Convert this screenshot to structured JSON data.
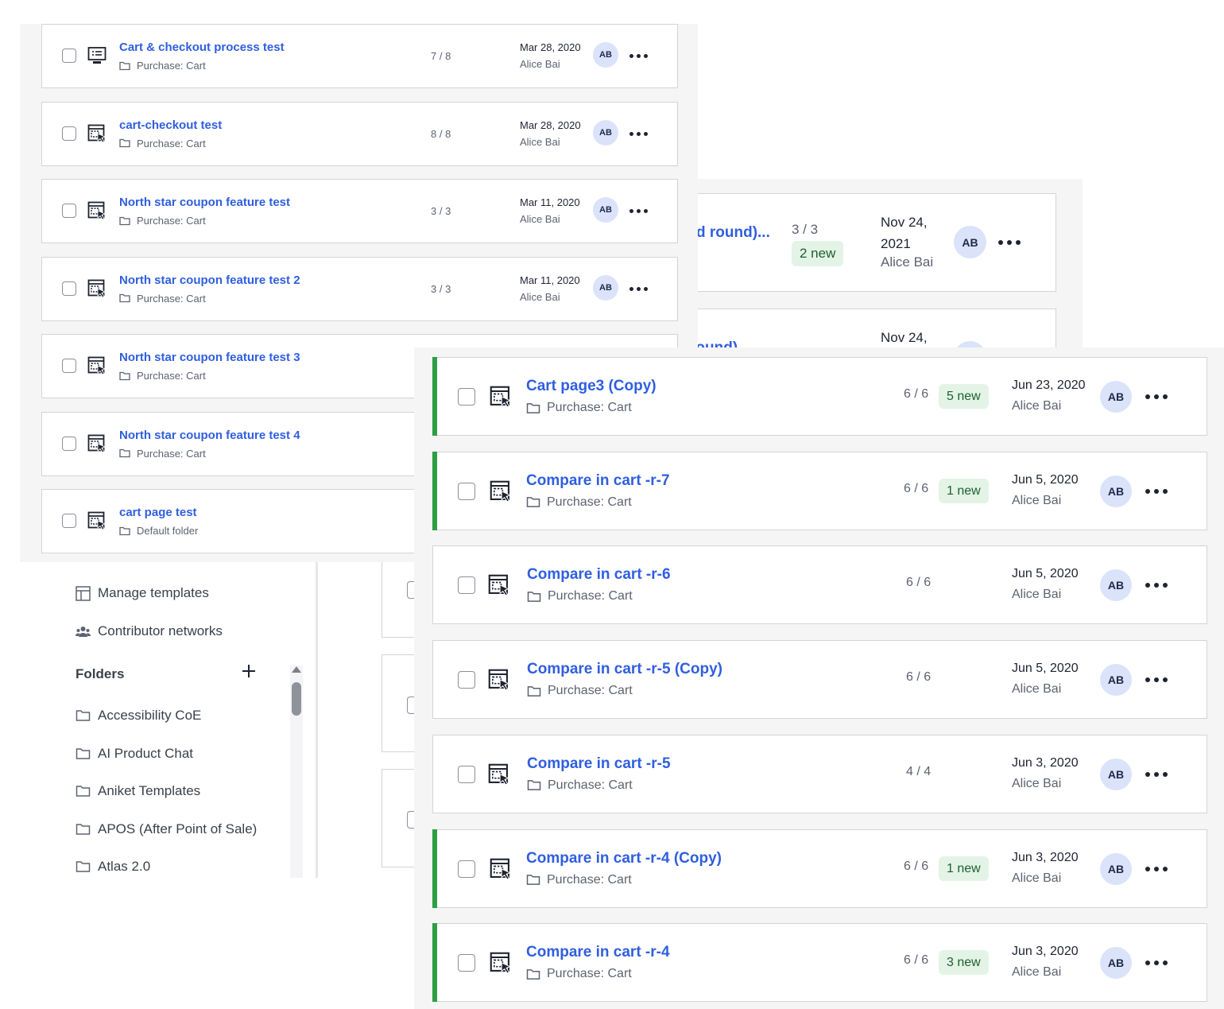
{
  "tests_small": [
    {
      "title": "Cart & checkout process test",
      "folder": "Purchase: Cart",
      "count": "7 / 8",
      "date": "Mar 28, 2020",
      "owner": "Alice Bai",
      "initials": "AB",
      "icon": "desktop-icon"
    },
    {
      "title": "cart-checkout test",
      "folder": "Purchase: Cart",
      "count": "8 / 8",
      "date": "Mar 28, 2020",
      "owner": "Alice Bai",
      "initials": "AB",
      "icon": "prototype-icon"
    },
    {
      "title": "North star coupon feature test",
      "folder": "Purchase: Cart",
      "count": "3 / 3",
      "date": "Mar 11, 2020",
      "owner": "Alice Bai",
      "initials": "AB",
      "icon": "prototype-icon"
    },
    {
      "title": "North star coupon feature test 2",
      "folder": "Purchase: Cart",
      "count": "3 / 3",
      "date": "Mar 11, 2020",
      "owner": "Alice Bai",
      "initials": "AB",
      "icon": "prototype-icon"
    },
    {
      "title": "North star coupon feature test 3",
      "folder": "Purchase: Cart",
      "icon": "prototype-icon"
    },
    {
      "title": "North star coupon feature test 4",
      "folder": "Purchase: Cart",
      "icon": "prototype-icon"
    },
    {
      "title": "cart page test",
      "folder": "Default folder",
      "icon": "prototype-icon"
    }
  ],
  "partial_row": {
    "title": "d round)...",
    "count": "3 / 3",
    "badge": "2 new",
    "date": "Nov 24, 2021",
    "owner": "Alice Bai",
    "initials": "AB"
  },
  "partial_row_2": {
    "title": "round)",
    "date": "Nov 24,"
  },
  "sidebar": {
    "items": [
      {
        "label": "Manage templates",
        "icon": "template-icon"
      },
      {
        "label": "Contributor networks",
        "icon": "people-icon"
      }
    ],
    "folders_title": "Folders",
    "folders": [
      "Accessibility CoE",
      "AI Product Chat",
      "Aniket Templates",
      "APOS (After Point of Sale)",
      "Atlas 2.0"
    ]
  },
  "tests_large": [
    {
      "title": "Cart page3 (Copy)",
      "folder": "Purchase: Cart",
      "count": "6 / 6",
      "badge": "5 new",
      "date": "Jun 23, 2020",
      "owner": "Alice Bai",
      "initials": "AB",
      "accent": true
    },
    {
      "title": "Compare in cart -r-7",
      "folder": "Purchase: Cart",
      "count": "6 / 6",
      "badge": "1 new",
      "date": "Jun 5, 2020",
      "owner": "Alice Bai",
      "initials": "AB",
      "accent": true
    },
    {
      "title": "Compare in cart -r-6",
      "folder": "Purchase: Cart",
      "count": "6 / 6",
      "badge": "",
      "date": "Jun 5, 2020",
      "owner": "Alice Bai",
      "initials": "AB",
      "accent": false
    },
    {
      "title": "Compare in cart -r-5 (Copy)",
      "folder": "Purchase: Cart",
      "count": "6 / 6",
      "badge": "",
      "date": "Jun 5, 2020",
      "owner": "Alice Bai",
      "initials": "AB",
      "accent": false
    },
    {
      "title": "Compare in cart -r-5",
      "folder": "Purchase: Cart",
      "count": "4 / 4",
      "badge": "",
      "date": "Jun 3, 2020",
      "owner": "Alice Bai",
      "initials": "AB",
      "accent": false
    },
    {
      "title": "Compare in cart -r-4 (Copy)",
      "folder": "Purchase: Cart",
      "count": "6 / 6",
      "badge": "1 new",
      "date": "Jun 3, 2020",
      "owner": "Alice Bai",
      "initials": "AB",
      "accent": true
    },
    {
      "title": "Compare in cart -r-4",
      "folder": "Purchase: Cart",
      "count": "6 / 6",
      "badge": "3 new",
      "date": "Jun 3, 2020",
      "owner": "Alice Bai",
      "initials": "AB",
      "accent": true
    }
  ],
  "colors": {
    "link": "#2f5ee0",
    "accent": "#2e9e45",
    "badge_bg": "#e3f4e6",
    "avatar_bg": "#dbe3fb"
  }
}
